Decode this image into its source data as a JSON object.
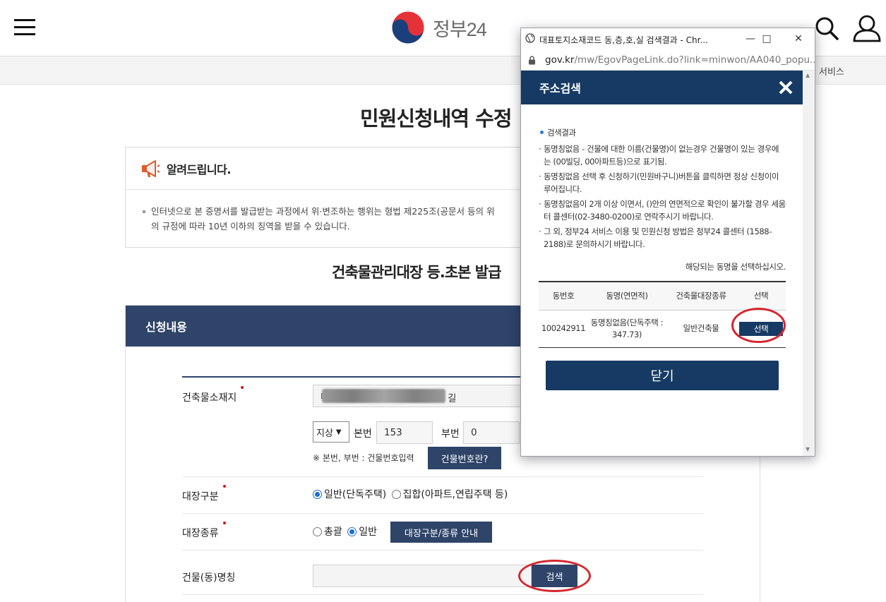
{
  "header": {
    "logo_text": "정부24",
    "subnav_service": "서비스"
  },
  "page": {
    "title": "민원신청내역 수정",
    "notice_title": "알려드립니다.",
    "notice_line1": "인터넷으로 본 증명서를 발급받는 과정에서 위·변조하는 행위는 형법 제225조(공문서 등의 위",
    "notice_line2": "의 규정에 따라 10년 이하의 징역을 받을 수 있습니다.",
    "sub_title": "건축물관리대장 등.초본 발급"
  },
  "form": {
    "section_title": "신청내용",
    "address_label": "건축물소재지",
    "address_prefix": "대",
    "address_suffix": "길",
    "land_type": "지상",
    "main_no_label": "본번",
    "main_no": "153",
    "sub_no_label": "부번",
    "sub_no": "0",
    "number_note": "※ 본번, 부번 : 건물번호입력",
    "building_no_btn": "건물번호란?",
    "register_class_label": "대장구분",
    "register_class_opt1": "일반(단독주택)",
    "register_class_opt2": "집합(아파트,연립주택 등)",
    "register_type_label": "대장종류",
    "register_type_opt1": "총괄",
    "register_type_opt2": "일반",
    "register_guide_btn": "대장구분/종류 안내",
    "building_name_label": "건물(동)명칭",
    "search_btn": "검색"
  },
  "popup": {
    "window_title": "대표토지소재코드 동,층,호,실 검색결과 - Chr...",
    "url_host": "gov.kr",
    "url_path": "/mw/EgovPageLink.do?link=minwon/AA040_popu...",
    "header_title": "주소검색",
    "result_title": "검색결과",
    "bullet1": "동명칭없음 - 건물에 대한 이름(건물명)이 없는경우 건물명이 있는 경우에는 (00빌딩, 00아파트등)으로 표기됨.",
    "bullet2": "동명칭없음 선택 후 신청하기(민원바구니)버튼을 클릭하면 정상 신청이이루어집니다.",
    "bullet3": "동명칭없음이 2개 이상 이면서, ()안의 연면적으로 확인이 불가할 경우 세움터 콜센터(02-3480-0200)로 연락주시기 바랍니다.",
    "bullet4": "그 외, 정부24 서비스 이용 및 민원신청 방법은 정부24 콜센터 (1588-2188)로 문의하시기 바랍니다.",
    "select_msg": "해당되는 동명을 선택하십시오.",
    "columns": [
      "동번호",
      "동명(연면적)",
      "건축물대장종류",
      "선택"
    ],
    "row": {
      "dong_no": "100242911",
      "dong_name": "동명칭없음(단독주택 : 347.73)",
      "register_kind": "일반건축물",
      "select_label": "선택"
    },
    "close_label": "닫기"
  },
  "colors": {
    "navy_form": "#2e4469",
    "navy_popup": "#163a63",
    "annotation_red": "#d6262f"
  }
}
